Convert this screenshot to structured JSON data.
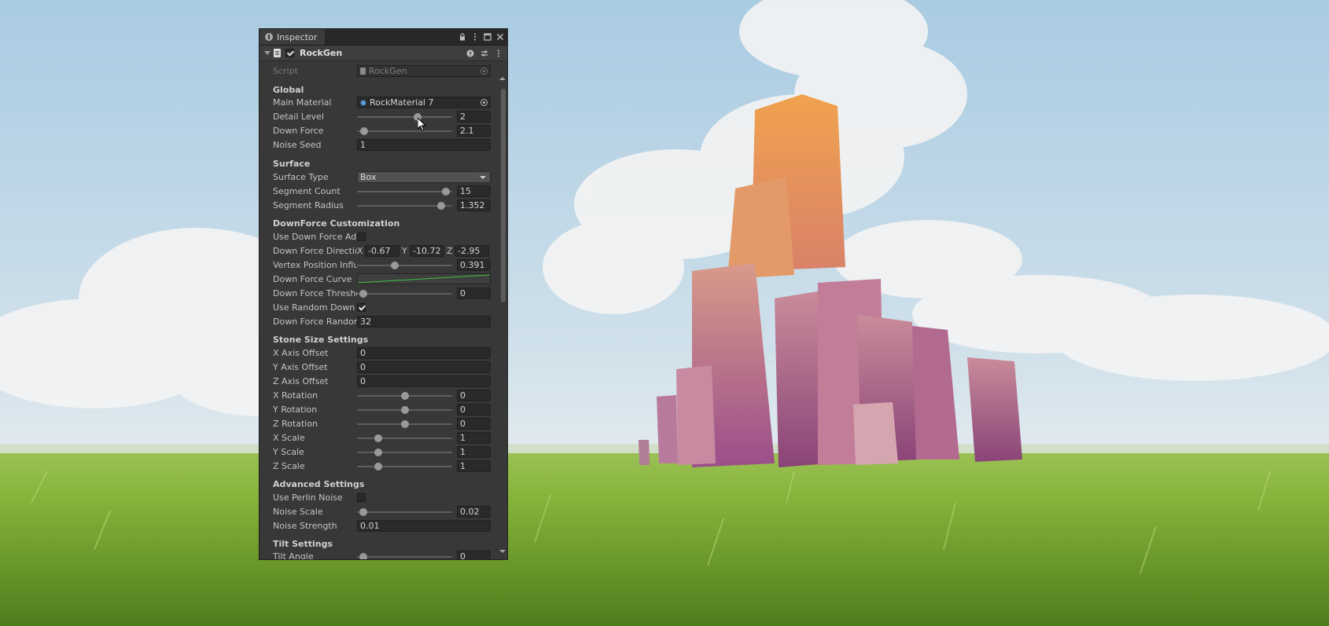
{
  "window": {
    "tab_label": "Inspector",
    "icons": [
      "info-icon",
      "lock-icon",
      "kebab-menu-icon",
      "maximize-icon",
      "close-icon"
    ]
  },
  "component": {
    "name": "RockGen",
    "enabled": true,
    "icons": [
      "help-icon",
      "preset-icon",
      "kebab-menu-icon"
    ]
  },
  "script_field": {
    "label": "Script",
    "value": "RockGen"
  },
  "sections": {
    "global": "Global",
    "surface": "Surface",
    "downforce": "DownForce Customization",
    "stone_size": "Stone Size Settings",
    "advanced": "Advanced Settings",
    "tilt": "Tilt Settings"
  },
  "global": {
    "main_material": {
      "label": "Main Material",
      "value": "RockMaterial 7"
    },
    "detail_level": {
      "label": "Detail Level",
      "value": "2",
      "fraction": 0.65
    },
    "down_force": {
      "label": "Down Force",
      "value": "2.1",
      "fraction": 0.04
    },
    "noise_seed": {
      "label": "Noise Seed",
      "value": "1"
    }
  },
  "surface": {
    "surface_type": {
      "label": "Surface Type",
      "value": "Box"
    },
    "segment_count": {
      "label": "Segment Count",
      "value": "15",
      "fraction": 0.97
    },
    "segment_radius": {
      "label": "Segment Radius",
      "value": "1.352",
      "fraction": 0.92
    }
  },
  "downforce": {
    "use_addition": {
      "label": "Use Down Force Addi",
      "checked": false
    },
    "direction": {
      "label": "Down Force Directior",
      "x": "-0.67",
      "y": "-10.72",
      "z": "-2.95",
      "axis_x": "X",
      "axis_y": "Y",
      "axis_z": "Z"
    },
    "vertex_influence": {
      "label": "Vertex Position Influe",
      "value": "0.391",
      "fraction": 0.39
    },
    "curve": {
      "label": "Down Force Curve"
    },
    "threshold": {
      "label": "Down Force Threshol",
      "value": "0",
      "fraction": 0.03
    },
    "use_random": {
      "label": "Use Random Down Fc",
      "checked": true
    },
    "random": {
      "label": "Down Force Random",
      "value": "32"
    }
  },
  "stone_size": {
    "x_offset": {
      "label": "X Axis Offset",
      "value": "0"
    },
    "y_offset": {
      "label": "Y Axis Offset",
      "value": "0"
    },
    "z_offset": {
      "label": "Z Axis Offset",
      "value": "0"
    },
    "x_rotation": {
      "label": "X Rotation",
      "value": "0",
      "fraction": 0.5
    },
    "y_rotation": {
      "label": "Y Rotation",
      "value": "0",
      "fraction": 0.5
    },
    "z_rotation": {
      "label": "Z Rotation",
      "value": "0",
      "fraction": 0.5
    },
    "x_scale": {
      "label": "X Scale",
      "value": "1",
      "fraction": 0.2
    },
    "y_scale": {
      "label": "Y Scale",
      "value": "1",
      "fraction": 0.2
    },
    "z_scale": {
      "label": "Z Scale",
      "value": "1",
      "fraction": 0.2
    }
  },
  "advanced": {
    "use_perlin": {
      "label": "Use Perlin Noise",
      "checked": false
    },
    "noise_scale": {
      "label": "Noise Scale",
      "value": "0.02",
      "fraction": 0.03
    },
    "noise_strength": {
      "label": "Noise Strength",
      "value": "0.01"
    }
  },
  "tilt": {
    "tilt_angle": {
      "label": "Tilt Angle",
      "value": "0",
      "fraction": 0.03
    }
  },
  "colors": {
    "panel_bg": "#383838",
    "field_bg": "#2a2a2a",
    "curve_line": "#3fbf3f"
  }
}
